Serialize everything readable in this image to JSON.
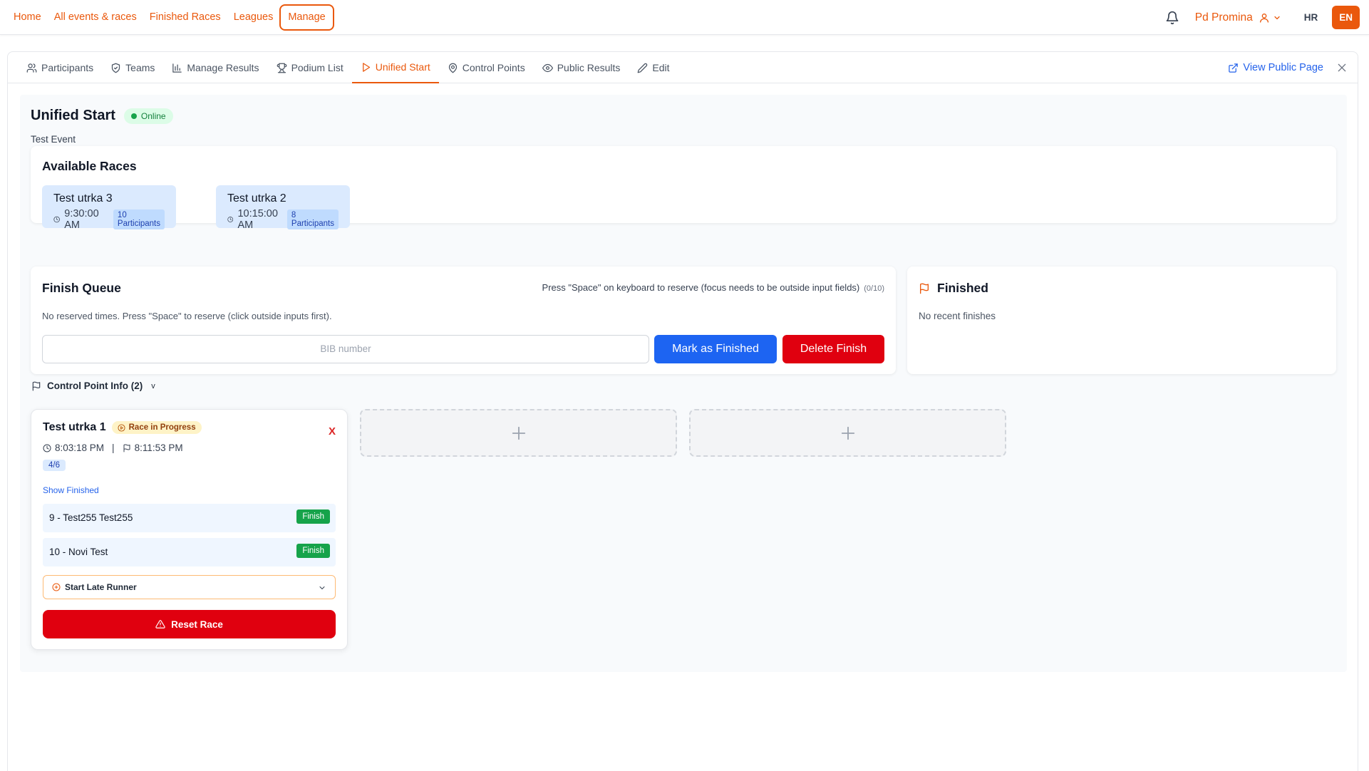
{
  "nav": {
    "links": [
      "Home",
      "All events & races",
      "Finished Races",
      "Leagues",
      "Manage"
    ],
    "user_name": "Pd Promina",
    "lang_hr": "HR",
    "lang_en": "EN"
  },
  "tabs": [
    {
      "label": "Participants",
      "icon": "users-icon"
    },
    {
      "label": "Teams",
      "icon": "shield-icon"
    },
    {
      "label": "Manage Results",
      "icon": "bar-chart-icon"
    },
    {
      "label": "Podium List",
      "icon": "trophy-icon"
    },
    {
      "label": "Unified Start",
      "icon": "play-icon",
      "active": true
    },
    {
      "label": "Control Points",
      "icon": "map-pin-icon"
    },
    {
      "label": "Public Results",
      "icon": "eye-icon"
    },
    {
      "label": "Edit",
      "icon": "pencil-icon"
    }
  ],
  "view_public": "View Public Page",
  "page": {
    "title": "Unified Start",
    "status": "Online",
    "subtitle": "Test Event"
  },
  "available_races": {
    "title": "Available Races",
    "races": [
      {
        "name": "Test utrka 3",
        "time": "9:30:00 AM",
        "participants": "10 Participants"
      },
      {
        "name": "Test utrka 2",
        "time": "10:15:00 AM",
        "participants": "8 Participants"
      }
    ]
  },
  "finish_queue": {
    "title": "Finish Queue",
    "hint": "Press \"Space\" on keyboard to reserve (focus needs to be outside input fields)",
    "count": "(0/10)",
    "empty": "No reserved times. Press \"Space\" to reserve (click outside inputs first).",
    "bib_placeholder": "BIB number",
    "mark_finished": "Mark as Finished",
    "delete_finish": "Delete Finish"
  },
  "finished": {
    "title": "Finished",
    "empty": "No recent finishes"
  },
  "control_point": {
    "header": "Control Point Info (2)",
    "caret": "v"
  },
  "race_card": {
    "name": "Test utrka 1",
    "status": "Race in Progress",
    "close": "X",
    "start_time": "8:03:18 PM",
    "separator": "|",
    "finish_time": "8:11:53 PM",
    "ratio": "4/6",
    "show_finished": "Show Finished",
    "runners": [
      {
        "label": "9 - Test255 Test255",
        "action": "Finish"
      },
      {
        "label": "10 - Novi Test",
        "action": "Finish"
      }
    ],
    "late_runner": "Start Late Runner",
    "reset": "Reset Race"
  },
  "colors": {
    "accent": "#ea580c",
    "primary_blue": "#1d64f2",
    "danger": "#e0000f",
    "success": "#16a34a"
  }
}
